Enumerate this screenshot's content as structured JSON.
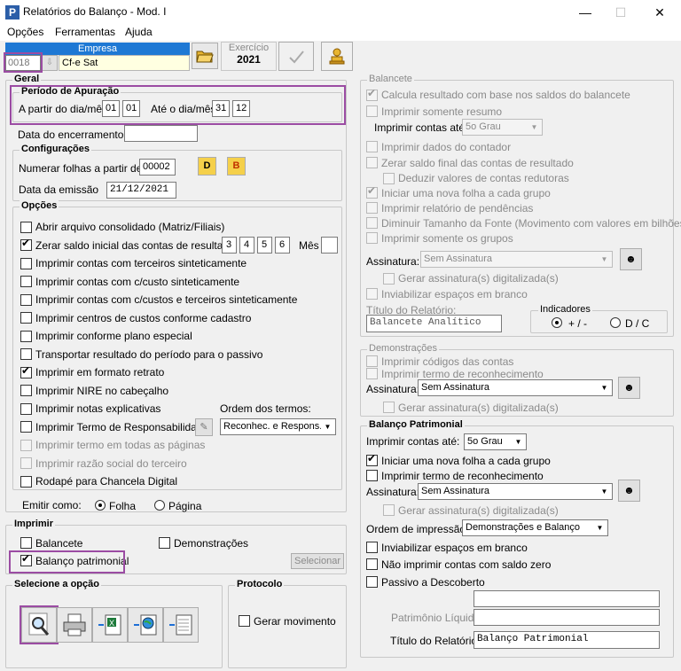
{
  "window": {
    "title": "Relatórios do Balanço - Mod. I"
  },
  "menu": [
    "Opções",
    "Ferramentas",
    "Ajuda"
  ],
  "empresa": {
    "label": "Empresa",
    "code": "0018",
    "name": "Cf-e Sat"
  },
  "exercicio": {
    "label": "Exercício",
    "year": "2021"
  },
  "geral": {
    "title": "Geral",
    "periodo": {
      "title": "Período de Apuração",
      "from_label": "A partir do dia/mês",
      "from_day": "01",
      "from_month": "01",
      "to_label": "Até o dia/mês",
      "to_day": "31",
      "to_month": "12"
    },
    "encerramento_label": "Data do encerramento"
  },
  "config": {
    "title": "Configurações",
    "numerar_label": "Numerar folhas a partir de",
    "numerar_value": "00002",
    "btn_d": "D",
    "btn_b": "B",
    "emissao_label": "Data da emissão",
    "emissao_value": "21/12/2021"
  },
  "opcoes": {
    "title": "Opções",
    "items": [
      "Abrir arquivo consolidado (Matriz/Filiais)",
      "Zerar saldo inicial das contas de resultado",
      "Imprimir contas com terceiros sinteticamente",
      "Imprimir contas com c/custo sinteticamente",
      "Imprimir contas com c/custos e terceiros sinteticamente",
      "Imprimir centros de custos conforme cadastro",
      "Imprimir conforme plano especial",
      "Transportar resultado do período para o passivo",
      "Imprimir em formato retrato",
      "Imprimir NIRE no cabeçalho",
      "Imprimir notas explicativas",
      "Imprimir Termo de Responsabilidade",
      "Imprimir termo em todas as páginas",
      "Imprimir razão social do terceiro",
      "Rodapé para Chancela Digital"
    ],
    "months": [
      "3",
      "4",
      "5",
      "6"
    ],
    "mes_label": "Mês",
    "ordem_label": "Ordem dos termos:",
    "ordem_value": "Reconhec. e Respons.",
    "emitir_label": "Emitir como:",
    "folha": "Folha",
    "pagina": "Página"
  },
  "imprimir": {
    "title": "Imprimir",
    "balancete": "Balancete",
    "demonstracoes": "Demonstrações",
    "balanco": "Balanço patrimonial",
    "selecionar": "Selecionar"
  },
  "selecione": {
    "title": "Selecione a opção"
  },
  "protocolo": {
    "title": "Protocolo",
    "gerar": "Gerar movimento"
  },
  "balancete": {
    "title": "Balancete",
    "calcula": "Calcula resultado com base nos saldos do balancete",
    "resumo": "Imprimir somente resumo",
    "contas_ate_label": "Imprimir contas até:",
    "contas_ate_value": "5o Grau",
    "dados_contador": "Imprimir dados do contador",
    "zerar_saldo": "Zerar saldo final das contas de resultado",
    "deduzir": "Deduzir valores de contas redutoras",
    "nova_folha": "Iniciar uma nova folha a cada grupo",
    "pendencias": "Imprimir relatório de pendências",
    "diminuir": "Diminuir Tamanho da Fonte (Movimento com valores em bilhões)",
    "grupos": "Imprimir somente os grupos",
    "assinatura_label": "Assinatura:",
    "assinatura_value": "Sem Assinatura",
    "gerar_assin": "Gerar assinatura(s) digitalizada(s)",
    "inviabilizar": "Inviabilizar espaços em branco",
    "titulo_label": "Título do Relatório:",
    "titulo_value": "Balancete Analítico",
    "indicadores": "Indicadores",
    "ind_plus": "+ / -",
    "ind_dc": "D / C"
  },
  "demonstracoes": {
    "title": "Demonstrações",
    "codigos": "Imprimir códigos das contas",
    "termo": "Imprimir termo de reconhecimento",
    "assinatura_label": "Assinatura:",
    "assinatura_value": "Sem Assinatura",
    "gerar_assin": "Gerar assinatura(s) digitalizada(s)"
  },
  "balanco": {
    "title": "Balanço Patrimonial",
    "contas_ate_label": "Imprimir contas até:",
    "contas_ate_value": "5o Grau",
    "nova_folha": "Iniciar uma nova folha a cada grupo",
    "termo": "Imprimir termo de reconhecimento",
    "assinatura_label": "Assinatura:",
    "assinatura_value": "Sem Assinatura",
    "gerar_assin": "Gerar assinatura(s) digitalizada(s)",
    "ordem_label": "Ordem de impressão:",
    "ordem_value": "Demonstrações e Balanço",
    "inviabilizar": "Inviabilizar espaços em branco",
    "nao_imprimir": "Não imprimir contas com saldo zero",
    "passivo": "Passivo a Descoberto",
    "patrimonio_label": "Patrimônio Líquido",
    "titulo_label": "Título do Relatório:",
    "titulo_value": "Balanço Patrimonial"
  }
}
